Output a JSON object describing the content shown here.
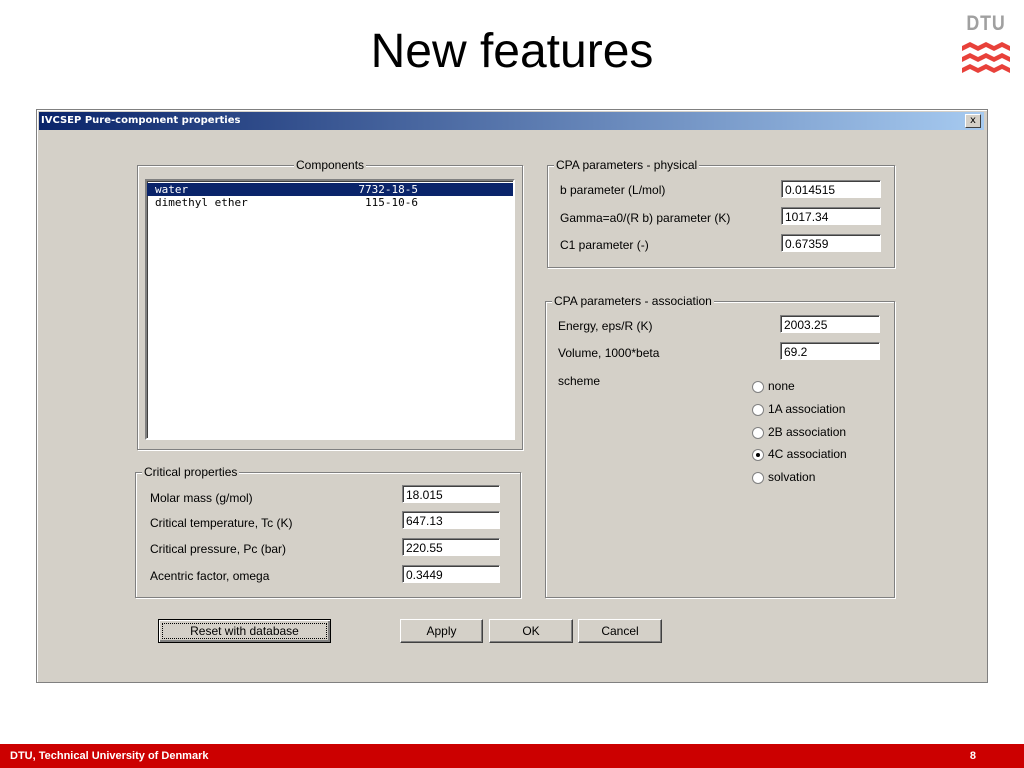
{
  "slide": {
    "title": "New features",
    "logo_text": "DTU",
    "footer_left": "DTU, Technical University of Denmark",
    "page_number": "8",
    "colors": {
      "footer": "#cc0000",
      "logo": "#e8413a"
    }
  },
  "window": {
    "title": "IVCSEP Pure-component properties",
    "close_label": "x"
  },
  "components": {
    "label": "Components",
    "items": [
      {
        "name": "water",
        "cas": "7732-18-5",
        "selected": true
      },
      {
        "name": "dimethyl ether",
        "cas": "115-10-6",
        "selected": false
      }
    ]
  },
  "critical": {
    "label": "Critical properties",
    "rows": [
      {
        "label": "Molar mass (g/mol)",
        "value": "18.015"
      },
      {
        "label": "Critical temperature, Tc (K)",
        "value": "647.13"
      },
      {
        "label": "Critical pressure, Pc (bar)",
        "value": "220.55"
      },
      {
        "label": "Acentric factor, omega",
        "value": "0.3449"
      }
    ]
  },
  "cpa_physical": {
    "label": "CPA parameters - physical",
    "rows": [
      {
        "label": "b parameter (L/mol)",
        "value": "0.014515"
      },
      {
        "label": "Gamma=a0/(R b)  parameter (K)",
        "value": "1017.34"
      },
      {
        "label": "C1 parameter (-)",
        "value": "0.67359"
      }
    ]
  },
  "cpa_association": {
    "label": "CPA parameters - association",
    "rows": [
      {
        "label": "Energy, eps/R (K)",
        "value": "2003.25"
      },
      {
        "label": "Volume, 1000*beta",
        "value": "69.2"
      }
    ],
    "scheme_label": "scheme",
    "schemes": [
      {
        "label": "none",
        "checked": false
      },
      {
        "label": "1A association",
        "checked": false
      },
      {
        "label": "2B association",
        "checked": false
      },
      {
        "label": "4C association",
        "checked": true
      },
      {
        "label": "solvation",
        "checked": false
      }
    ]
  },
  "buttons": {
    "reset": "Reset with database",
    "apply": "Apply",
    "ok": "OK",
    "cancel": "Cancel"
  }
}
